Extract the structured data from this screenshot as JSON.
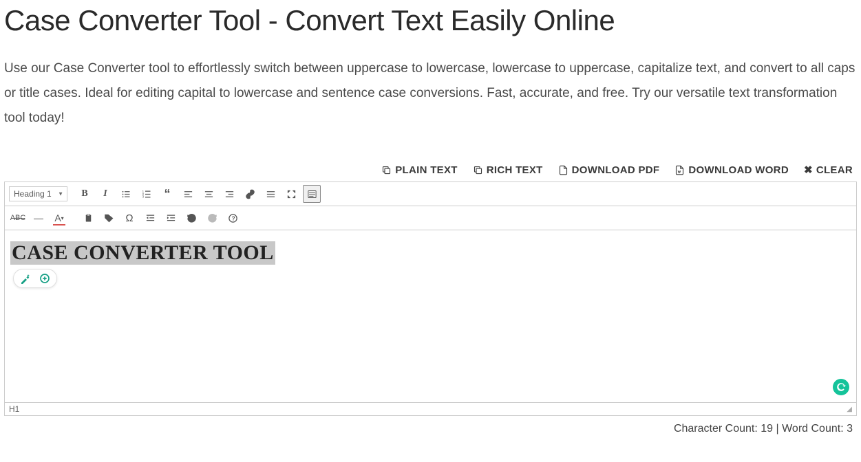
{
  "page": {
    "title": "Case Converter Tool - Convert Text Easily Online",
    "description": "Use our Case Converter tool to effortlessly switch between uppercase to lowercase, lowercase to uppercase, capitalize text, and convert to all caps or title cases. Ideal for editing capital to lowercase and sentence case conversions. Fast, accurate, and free. Try our versatile text transformation tool today!"
  },
  "actions": {
    "plain_text": "PLAIN TEXT",
    "rich_text": "RICH TEXT",
    "download_pdf": "DOWNLOAD PDF",
    "download_word": "DOWNLOAD WORD",
    "clear": "CLEAR"
  },
  "toolbar": {
    "heading_select": "Heading 1"
  },
  "editor": {
    "content_h1": "CASE CONVERTER TOOL",
    "status_tag": "H1"
  },
  "counts": {
    "char_label": "Character Count:",
    "char_value": "19",
    "word_label": "Word Count:",
    "word_value": "3",
    "separator": " | "
  }
}
